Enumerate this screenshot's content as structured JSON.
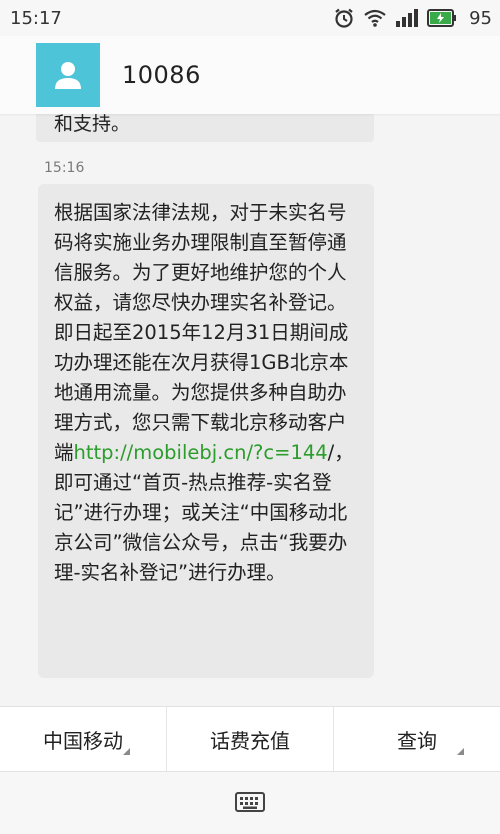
{
  "status_bar": {
    "time": "15:17",
    "battery": "95",
    "icons": [
      "alarm-icon",
      "wifi-icon",
      "signal-icon",
      "battery-icon"
    ]
  },
  "header": {
    "contact": "10086",
    "avatar_icon": "person-icon",
    "avatar_color": "#4dc4d8"
  },
  "messages": {
    "previous_fragment": "和支持。",
    "timestamp": "15:16",
    "body_before_link": "根据国家法律法规，对于未实名号码将实施业务办理限制直至暂停通信服务。为了更好地维护您的个人权益，请您尽快办理实名补登记。即日起至2015年12月31日期间成功办理还能在次月获得1GB北京本地通用流量。为您提供多种自助办理方式，您只需下载北京移动客户端",
    "link": "http://mobilebj.cn/?c=144",
    "body_after_link": "/，即可通过“首页-热点推荐-实名登记”进行办理；或关注“中国移动北京公司”微信公众号，点击“我要办理-实名补登记”进行办理。",
    "link_color": "#2c9c2c"
  },
  "menu": {
    "items": [
      {
        "label": "中国移动",
        "has_submenu": true
      },
      {
        "label": "话费充值",
        "has_submenu": false
      },
      {
        "label": "查询",
        "has_submenu": true
      }
    ]
  },
  "keyboard": {
    "icon": "keyboard-icon"
  }
}
